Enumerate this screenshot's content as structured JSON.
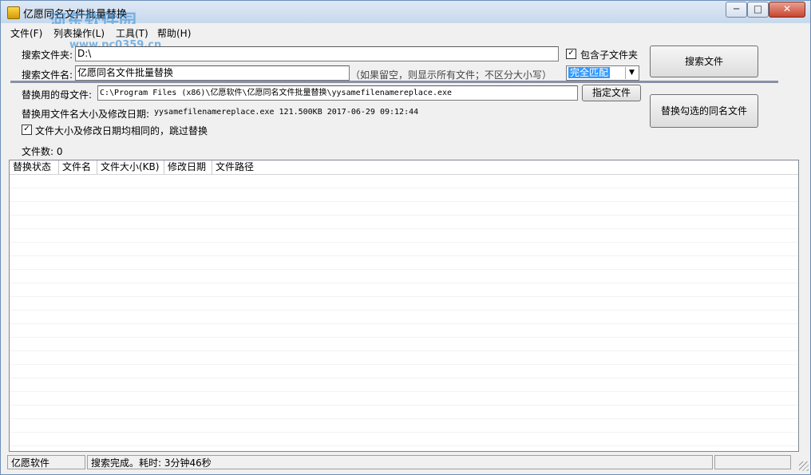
{
  "window": {
    "title": "亿愿同名文件批量替换",
    "watermark": "河东软件园",
    "watermark_url": "www.pc0359.cn",
    "min_glyph": "─",
    "max_glyph": "□",
    "close_glyph": "✕"
  },
  "menu": {
    "file": "文件(F)",
    "list_ops": "列表操作(L)",
    "tools": "工具(T)",
    "help": "帮助(H)"
  },
  "search": {
    "folder_label": "搜索文件夹:",
    "folder_value": "D:\\",
    "include_sub_label": "包含子文件夹",
    "include_sub_checked": true,
    "name_label": "搜索文件名:",
    "name_value": "亿愿同名文件批量替换",
    "name_hint": "（如果留空，则显示所有文件；不区分大小写）",
    "match_mode": "完全匹配",
    "search_button": "搜索文件"
  },
  "replace": {
    "source_label": "替换用的母文件:",
    "source_value": "C:\\Program Files (x86)\\亿愿软件\\亿愿同名文件批量替换\\yysamefilenamereplace.exe",
    "specify_button": "指定文件",
    "info_label": "替换用文件名大小及修改日期:",
    "info_value": "yysamefilenamereplace.exe 121.500KB 2017-06-29 09:12:44",
    "skip_label": "文件大小及修改日期均相同的，跳过替换",
    "skip_checked": true,
    "replace_button": "替换勾选的同名文件",
    "file_count": "文件数: 0"
  },
  "table": {
    "columns": [
      "替换状态",
      "文件名",
      "文件大小(KB)",
      "修改日期",
      "文件路径"
    ],
    "rows": []
  },
  "status": {
    "company": "亿愿软件",
    "message": "搜索完成。耗时: 3分钟46秒"
  },
  "colors": {
    "title_gradient": "#c7d8ec",
    "selection": "#3399ff",
    "watermark": "#288cdc"
  }
}
